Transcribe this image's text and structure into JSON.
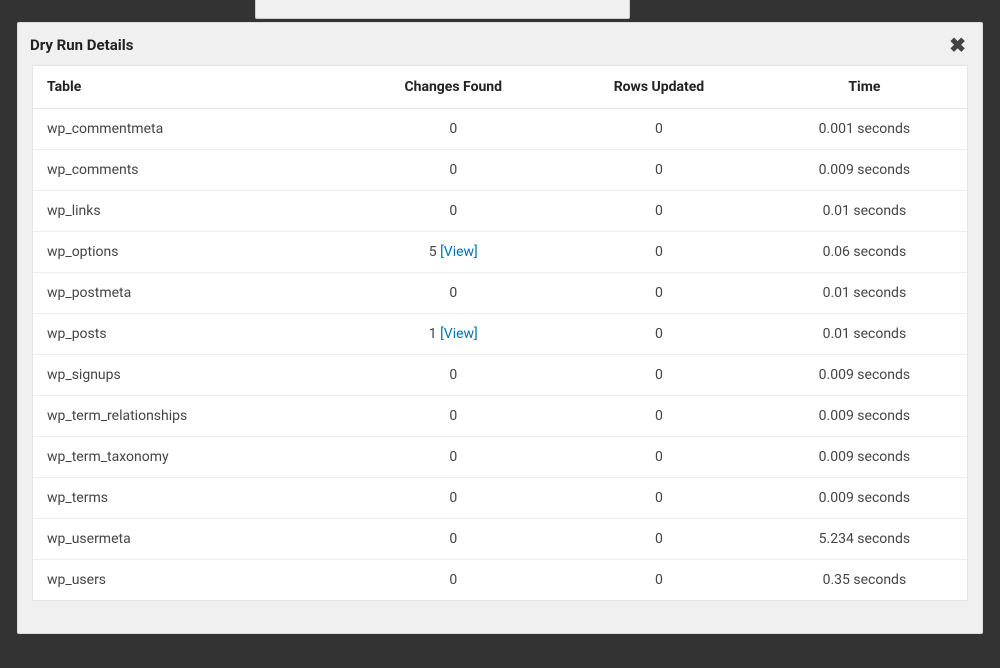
{
  "modal": {
    "title": "Dry Run Details",
    "close_label": "✖"
  },
  "link": {
    "view": "[View]"
  },
  "headers": {
    "table": "Table",
    "changes_found": "Changes Found",
    "rows_updated": "Rows Updated",
    "time": "Time"
  },
  "rows": [
    {
      "table": "wp_commentmeta",
      "changes": "0",
      "has_view": false,
      "rows_updated": "0",
      "time": "0.001 seconds"
    },
    {
      "table": "wp_comments",
      "changes": "0",
      "has_view": false,
      "rows_updated": "0",
      "time": "0.009 seconds"
    },
    {
      "table": "wp_links",
      "changes": "0",
      "has_view": false,
      "rows_updated": "0",
      "time": "0.01 seconds"
    },
    {
      "table": "wp_options",
      "changes": "5",
      "has_view": true,
      "rows_updated": "0",
      "time": "0.06 seconds"
    },
    {
      "table": "wp_postmeta",
      "changes": "0",
      "has_view": false,
      "rows_updated": "0",
      "time": "0.01 seconds"
    },
    {
      "table": "wp_posts",
      "changes": "1",
      "has_view": true,
      "rows_updated": "0",
      "time": "0.01 seconds"
    },
    {
      "table": "wp_signups",
      "changes": "0",
      "has_view": false,
      "rows_updated": "0",
      "time": "0.009 seconds"
    },
    {
      "table": "wp_term_relationships",
      "changes": "0",
      "has_view": false,
      "rows_updated": "0",
      "time": "0.009 seconds"
    },
    {
      "table": "wp_term_taxonomy",
      "changes": "0",
      "has_view": false,
      "rows_updated": "0",
      "time": "0.009 seconds"
    },
    {
      "table": "wp_terms",
      "changes": "0",
      "has_view": false,
      "rows_updated": "0",
      "time": "0.009 seconds"
    },
    {
      "table": "wp_usermeta",
      "changes": "0",
      "has_view": false,
      "rows_updated": "0",
      "time": "5.234 seconds"
    },
    {
      "table": "wp_users",
      "changes": "0",
      "has_view": false,
      "rows_updated": "0",
      "time": "0.35 seconds"
    }
  ]
}
